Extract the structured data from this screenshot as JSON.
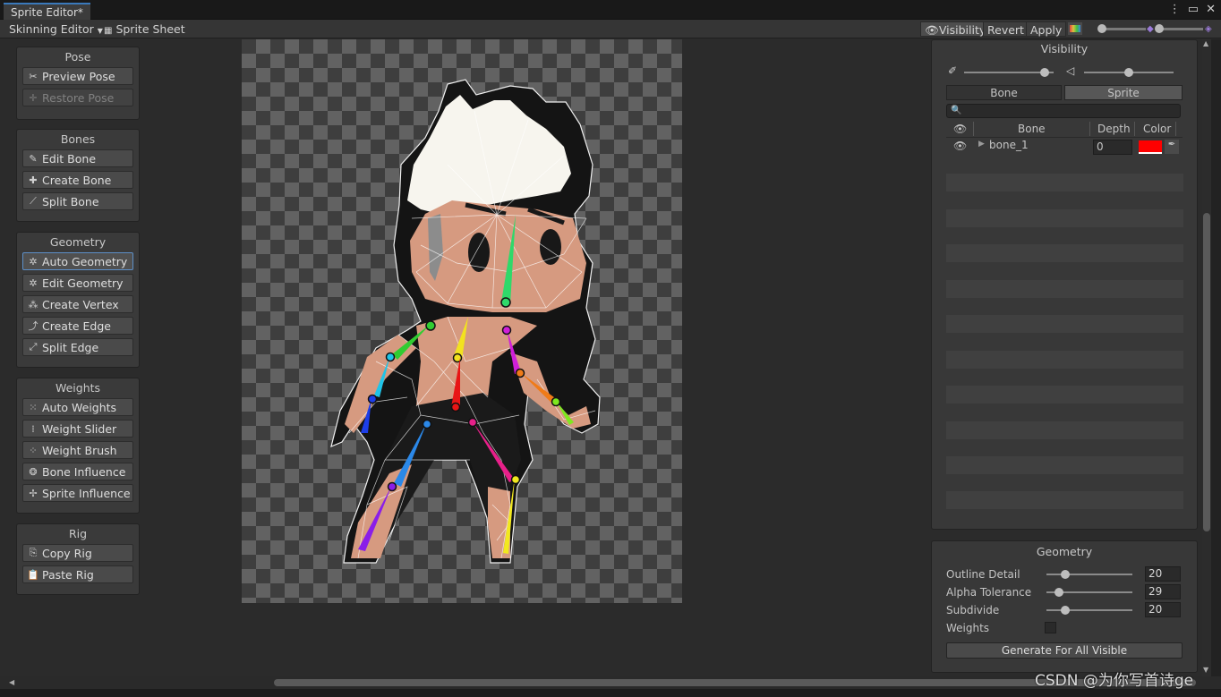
{
  "window": {
    "tab_title": "Sprite Editor*",
    "menu_icon": "kebab-icon",
    "maximize_icon": "maximize-icon",
    "close_icon": "close-icon"
  },
  "toolbar": {
    "mode_dropdown": "Skinning Editor",
    "sprite_sheet": "Sprite Sheet",
    "visibility": "Visibility",
    "revert": "Revert",
    "apply": "Apply"
  },
  "panels": {
    "pose": {
      "title": "Pose",
      "buttons": [
        "Preview Pose",
        "Restore Pose"
      ]
    },
    "bones": {
      "title": "Bones",
      "buttons": [
        "Edit Bone",
        "Create Bone",
        "Split Bone"
      ]
    },
    "geometry_tools": {
      "title": "Geometry",
      "buttons": [
        "Auto Geometry",
        "Edit Geometry",
        "Create Vertex",
        "Create Edge",
        "Split Edge"
      ]
    },
    "weights": {
      "title": "Weights",
      "buttons": [
        "Auto Weights",
        "Weight Slider",
        "Weight Brush",
        "Bone Influence",
        "Sprite Influence"
      ]
    },
    "rig": {
      "title": "Rig",
      "buttons": [
        "Copy Rig",
        "Paste Rig"
      ]
    }
  },
  "visibility_panel": {
    "title": "Visibility",
    "tabs": [
      "Bone",
      "Sprite"
    ],
    "search_placeholder": "",
    "columns": {
      "bone": "Bone",
      "depth": "Depth",
      "color": "Color"
    },
    "rows": [
      {
        "name": "bone_1",
        "depth": "0",
        "color": "#ff0000"
      }
    ],
    "bone_opacity": 0.9,
    "sprite_opacity": 0.5
  },
  "geometry_panel": {
    "title": "Geometry",
    "outline_detail_label": "Outline Detail",
    "outline_detail_value": "20",
    "alpha_tolerance_label": "Alpha Tolerance",
    "alpha_tolerance_value": "29",
    "subdivide_label": "Subdivide",
    "subdivide_value": "20",
    "weights_label": "Weights",
    "weights_checked": false,
    "generate_button": "Generate For All Visible"
  },
  "watermark": "CSDN @为你写首诗ge",
  "colors": {
    "accent": "#3a79bb",
    "panel_bg": "#3a3a3a",
    "button_bg": "#4a4a4a",
    "bone_color": "#ff0000"
  }
}
